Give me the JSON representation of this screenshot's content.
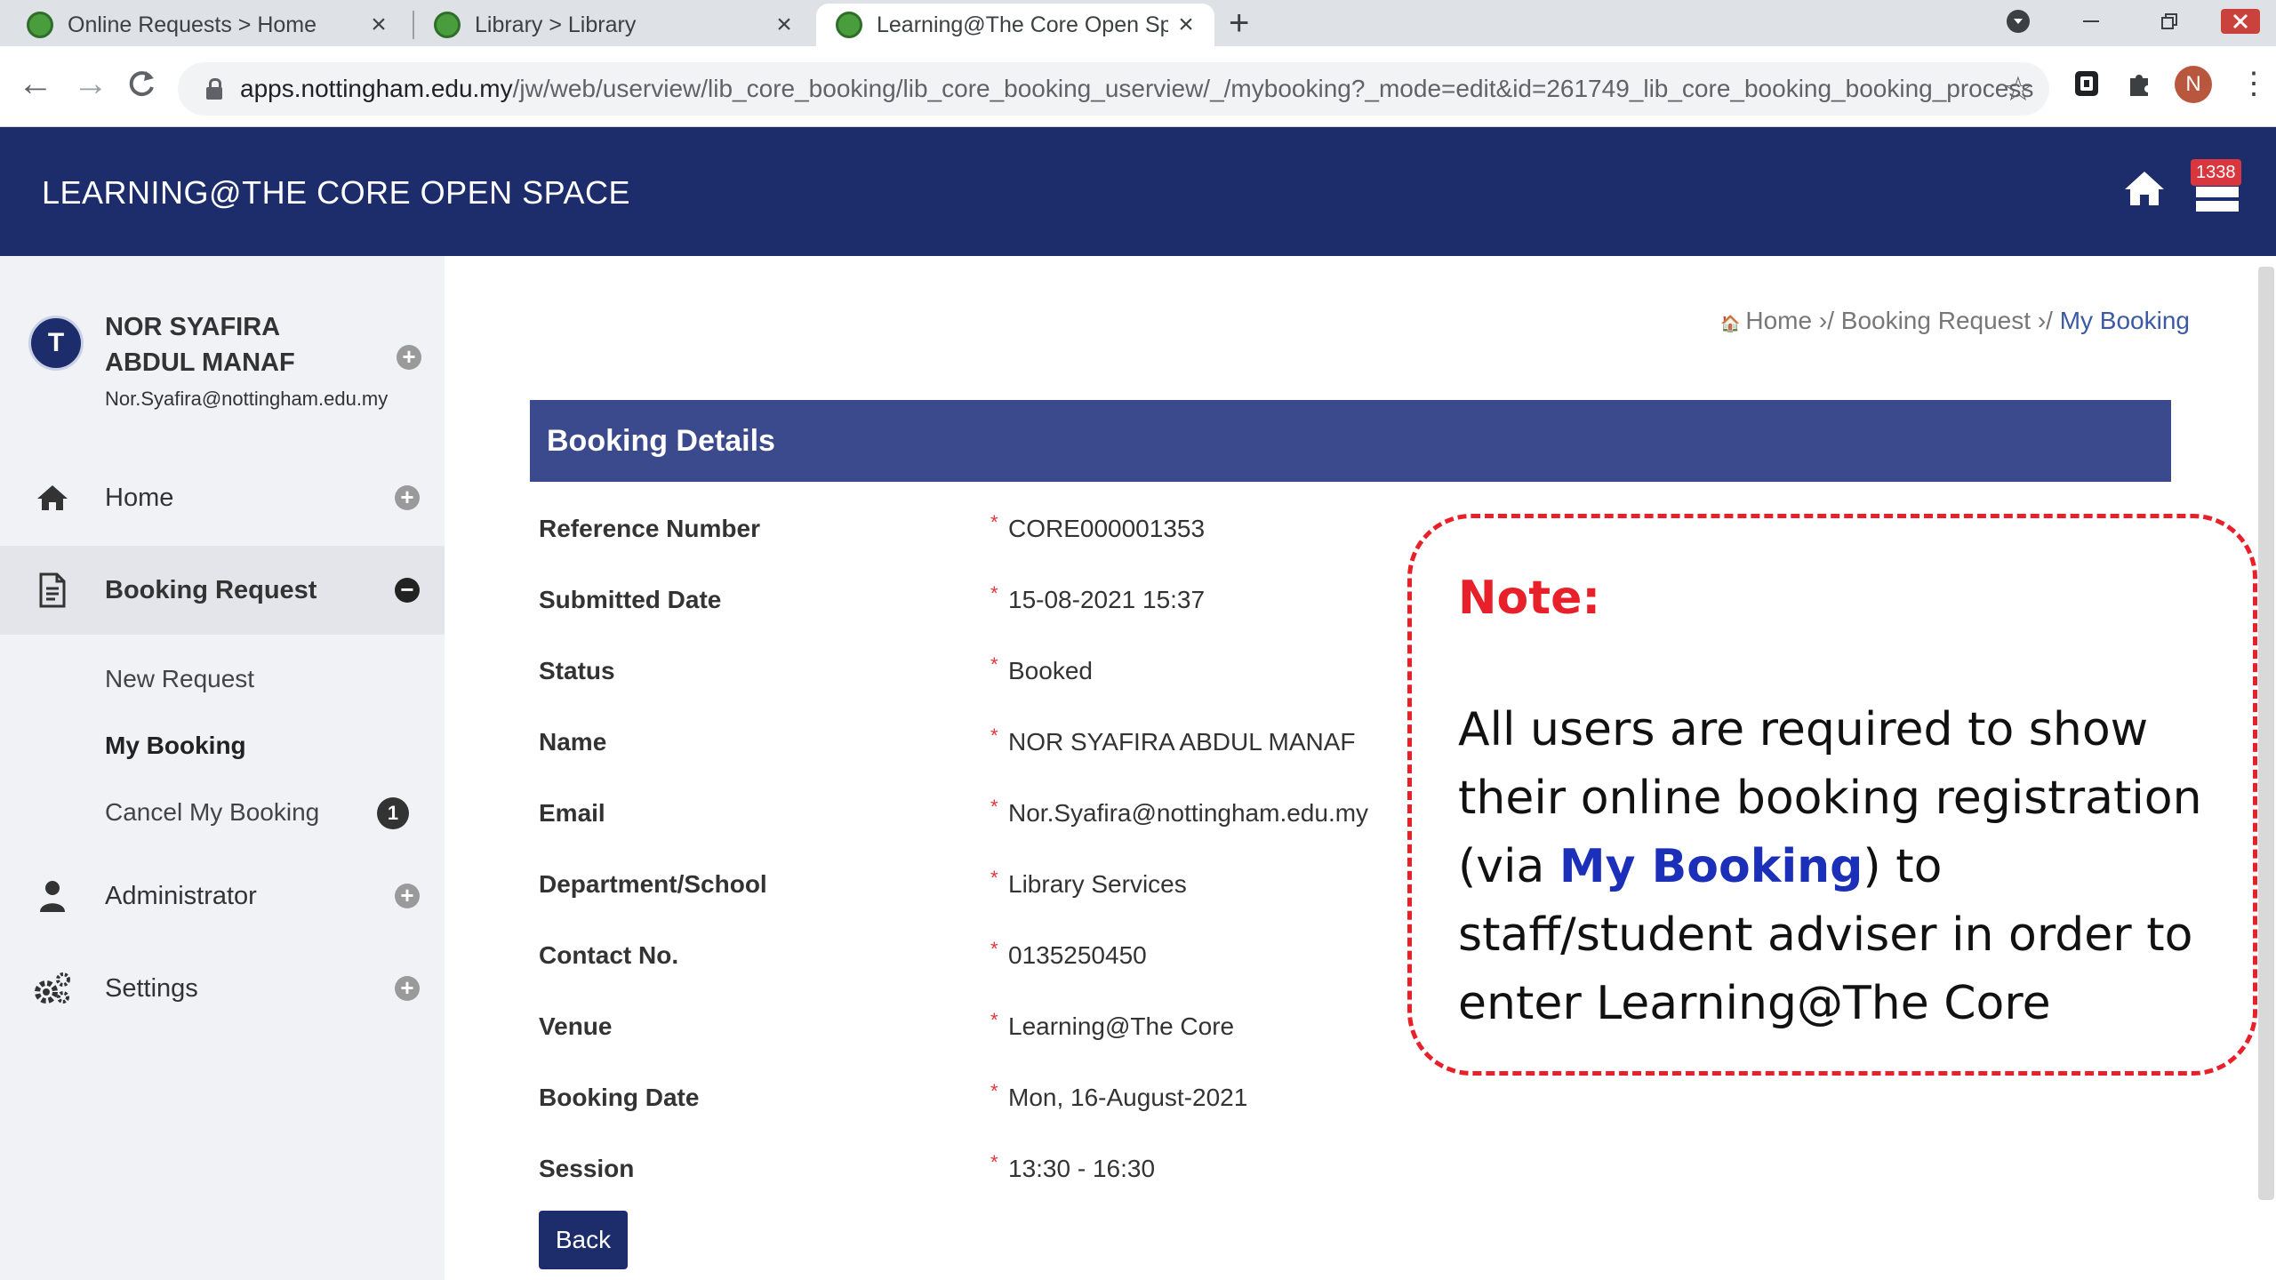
{
  "browser": {
    "tabs": [
      {
        "title": "Online Requests > Home",
        "active": false
      },
      {
        "title": "Library > Library",
        "active": false
      },
      {
        "title": "Learning@The Core Open Space",
        "active": true
      }
    ],
    "new_tab": "+",
    "close_symbol": "×",
    "url_host": "apps.nottingham.edu.my",
    "url_path": "/jw/web/userview/lib_core_booking/lib_core_booking_userview/_/mybooking?_mode=edit&id=261749_lib_core_booking_booking_process",
    "profile_initial": "N"
  },
  "header": {
    "title": "LEARNING@THE CORE OPEN SPACE",
    "inbox_count": "1338"
  },
  "user": {
    "name": "NOR SYAFIRA ABDUL MANAF",
    "email": "Nor.Syafira@nottingham.edu.my",
    "avatar_letter": "T"
  },
  "sidebar": {
    "items": [
      {
        "label": "Home",
        "icon": "home-icon"
      },
      {
        "label": "Booking Request",
        "icon": "document-icon",
        "active": true
      },
      {
        "label": "Administrator",
        "icon": "person-icon"
      },
      {
        "label": "Settings",
        "icon": "gears-icon"
      }
    ],
    "subitems": [
      {
        "label": "New Request"
      },
      {
        "label": "My Booking",
        "current": true
      },
      {
        "label": "Cancel My Booking",
        "count": "1"
      }
    ]
  },
  "breadcrumb": {
    "home": "Home",
    "sep": "›/",
    "booking_request": "Booking Request",
    "current": "My Booking"
  },
  "panel": {
    "title": "Booking Details",
    "fields": [
      {
        "label": "Reference Number",
        "value": "CORE000001353"
      },
      {
        "label": "Submitted Date",
        "value": "15-08-2021 15:37"
      },
      {
        "label": "Status",
        "value": "Booked"
      },
      {
        "label": "Name",
        "value": "NOR SYAFIRA ABDUL MANAF"
      },
      {
        "label": "Email",
        "value": "Nor.Syafira@nottingham.edu.my"
      },
      {
        "label": "Department/School",
        "value": "Library Services"
      },
      {
        "label": "Contact No.",
        "value": "0135250450"
      },
      {
        "label": "Venue",
        "value": "Learning@The Core"
      },
      {
        "label": "Booking Date",
        "value": "Mon, 16-August-2021"
      },
      {
        "label": "Session",
        "value": "13:30 - 16:30"
      }
    ],
    "back_label": "Back"
  },
  "note": {
    "title": "Note:",
    "text_before": "All users are required to show their online booking registration (via ",
    "link_text": "My Booking",
    "text_after": ") to staff/student adviser in order to enter Learning@The Core"
  },
  "colors": {
    "header_bg": "#1d2d6b",
    "panel_header_bg": "#3b4a8c",
    "note_border": "#e8202a",
    "note_link": "#1b2fb8"
  }
}
